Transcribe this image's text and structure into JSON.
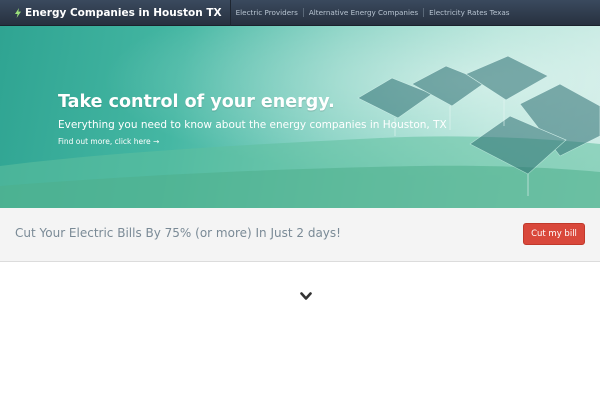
{
  "navbar": {
    "brand": "Energy Companies in Houston TX",
    "brand_icon": "bolt-icon",
    "items": [
      {
        "label": "Electric Providers"
      },
      {
        "label": "Alternative Energy Companies"
      },
      {
        "label": "Electricity Rates Texas"
      }
    ]
  },
  "hero": {
    "title": "Take control of your energy.",
    "subtitle": "Everything you need to know about the energy companies in Houston, TX",
    "link": "Find out more, click here →"
  },
  "cta": {
    "text": "Cut Your Electric Bills By 75% (or more) In Just 2 days!",
    "button": "Cut my bill",
    "button_color": "#d9483b"
  },
  "scroll": {
    "icon": "chevron-down-icon"
  },
  "colors": {
    "navbar": "#2f3b4b",
    "hero_teal": "#45b7a3",
    "cta_band": "#f4f4f4"
  }
}
